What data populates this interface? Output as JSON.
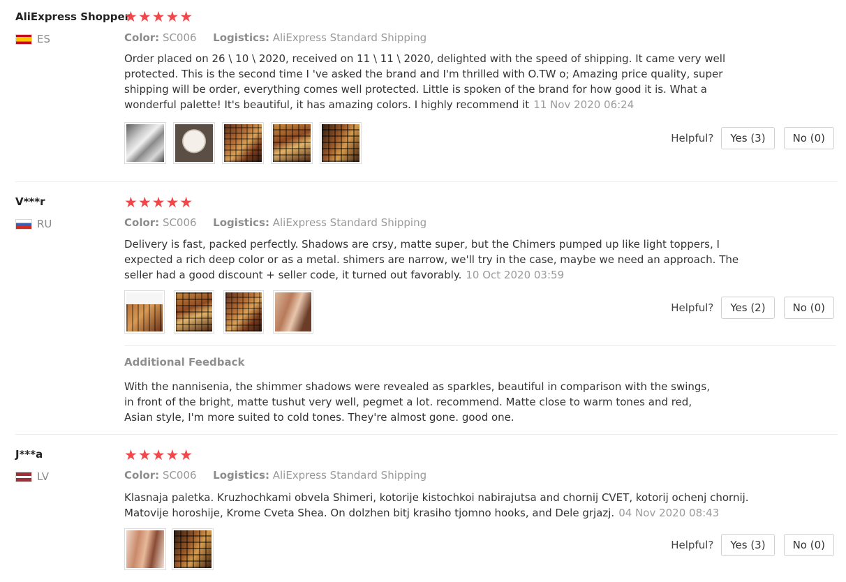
{
  "labels": {
    "color": "Color:",
    "logistics": "Logistics:",
    "helpful": "Helpful?",
    "additional_feedback": "Additional Feedback"
  },
  "star_glyph": "★★★★★",
  "reviews": [
    {
      "user": "AliExpress Shopper",
      "country": "ES",
      "rating": 5,
      "color": "SC006",
      "logistics": "AliExpress Standard Shipping",
      "text": "Order placed on 26 \\ 10 \\ 2020, received on 11 \\ 11 \\ 2020, delighted with the speed of shipping. It came very well protected. This is the second time I 've asked the brand and I'm thrilled with O.TW o; Amazing price quality, super shipping will be order, everything comes well protected. Little is spoken of the brand for how good it is. What a wonderful palette! It's beautiful, it has amazing colors. I highly recommend it",
      "date": "11 Nov 2020 06:24",
      "photos": [
        "case-photo",
        "box-photo",
        "palette-photo",
        "palette-photo",
        "palette-photo"
      ],
      "helpful_yes": "Yes (3)",
      "helpful_no": "No (0)"
    },
    {
      "user": "V***r",
      "country": "RU",
      "rating": 5,
      "color": "SC006",
      "logistics": "AliExpress Standard Shipping",
      "text": "Delivery is fast, packed perfectly. Shadows are crsy, matte super, but the Chimers pumped up like light toppers, I expected a rich deep color or as a metal. shimers are narrow, we'll try in the case, maybe we need an approach. The seller had a good discount + seller code, it turned out favorably.",
      "date": "10 Oct 2020 03:59",
      "photos": [
        "palette-photo",
        "palette-photo",
        "palette-photo",
        "swatch-photo"
      ],
      "helpful_yes": "Yes (2)",
      "helpful_no": "No (0)",
      "additional_feedback": "With the nannisenia, the shimmer shadows were revealed as sparkles, beautiful in comparison with the swings, in front of the bright, matte tushut very well, pegmet a lot. recommend. Matte close to warm tones and red, Asian style, I'm more suited to cold tones. They're almost gone. good one."
    },
    {
      "user": "J***a",
      "country": "LV",
      "rating": 5,
      "color": "SC006",
      "logistics": "AliExpress Standard Shipping",
      "text": "Klasnaja paletka. Kruzhochkami obvela Shimeri, kotorije kistochkoi nabirajutsa and chornij CVET, kotorij ochenj chornij. Matovije horoshije, Krome Cveta Shea. On dolzhen bitj krasiho tjomno hooks, and Dele grjazj.",
      "date": "04 Nov 2020 08:43",
      "photos": [
        "swatch-photo",
        "palette-photo"
      ],
      "helpful_yes": "Yes (3)",
      "helpful_no": "No (0)"
    }
  ],
  "colors": {
    "star": "#f0474b",
    "muted_text": "#999999",
    "body_text": "#333333"
  }
}
